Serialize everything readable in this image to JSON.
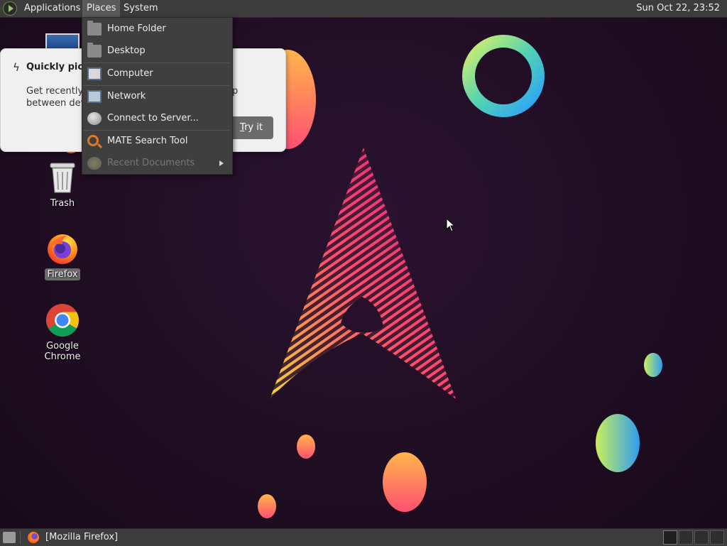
{
  "top_panel": {
    "menus": [
      "Applications",
      "Places",
      "System"
    ],
    "clock": "Sun Oct 22, 23:52"
  },
  "places_menu": {
    "items": [
      {
        "label": "Home Folder",
        "icon": "home-folder-icon",
        "enabled": true
      },
      {
        "label": "Desktop",
        "icon": "desktop-folder-icon",
        "enabled": true
      },
      {
        "label": "Computer",
        "icon": "computer-icon",
        "enabled": true
      },
      {
        "label": "Network",
        "icon": "network-icon",
        "enabled": true
      },
      {
        "label": "Connect to Server...",
        "icon": "globe-icon",
        "enabled": true
      },
      {
        "label": "MATE Search Tool",
        "icon": "search-tool-icon",
        "enabled": true
      },
      {
        "label": "Recent Documents",
        "icon": "recent-documents-icon",
        "enabled": false,
        "submenu": true
      }
    ]
  },
  "notification": {
    "title": "Quickly pick u",
    "body": "Get recently c                                                    p between devi",
    "body_line1": "Get recently c",
    "body_line1_tail": "p",
    "body_line2": "between devi",
    "button": {
      "accel": "T",
      "rest": "ry it"
    }
  },
  "desktop_icons": [
    {
      "label": "Trash",
      "icon": "trash-icon"
    },
    {
      "label": "Firefox",
      "icon": "firefox-icon",
      "selected": true
    },
    {
      "label": "Google Chrome",
      "icon": "chrome-icon"
    }
  ],
  "bottom_panel": {
    "task": "[Mozilla Firefox]",
    "workspaces": 4
  },
  "colors": {
    "panel": "#3c3c3c",
    "menu": "#3f3f3f",
    "wallpaper": "#200d22",
    "arch_pink": "#e8307a",
    "arch_yellow": "#f5d23a"
  }
}
